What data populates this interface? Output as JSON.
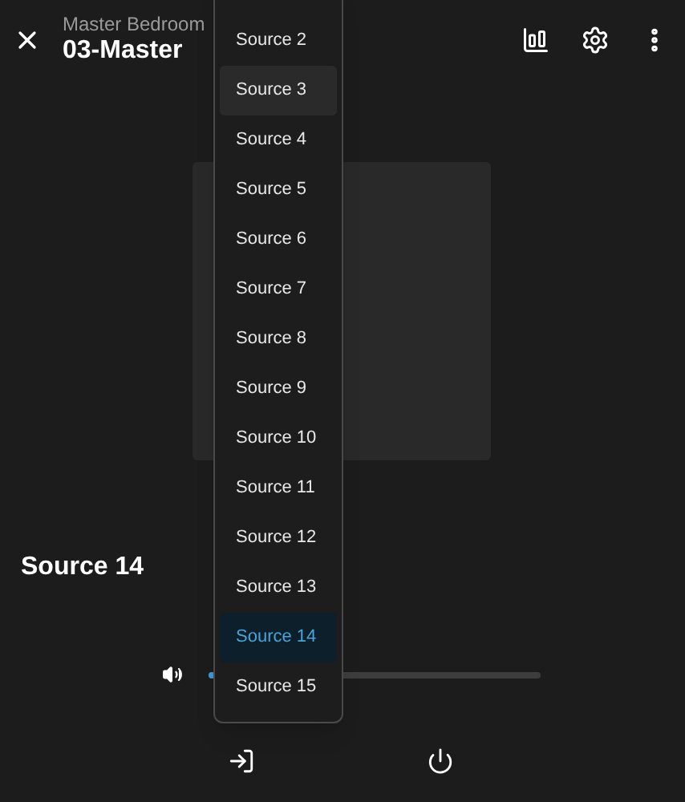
{
  "header": {
    "subtitle": "Master Bedroom",
    "title": "03-Master"
  },
  "now_playing": {
    "source": "Source 14"
  },
  "volume": {
    "level": 0.01
  },
  "source_menu": {
    "items": [
      {
        "label": "Source 2",
        "selected": false,
        "hovered": false
      },
      {
        "label": "Source 3",
        "selected": false,
        "hovered": true
      },
      {
        "label": "Source 4",
        "selected": false,
        "hovered": false
      },
      {
        "label": "Source 5",
        "selected": false,
        "hovered": false
      },
      {
        "label": "Source 6",
        "selected": false,
        "hovered": false
      },
      {
        "label": "Source 7",
        "selected": false,
        "hovered": false
      },
      {
        "label": "Source 8",
        "selected": false,
        "hovered": false
      },
      {
        "label": "Source 9",
        "selected": false,
        "hovered": false
      },
      {
        "label": "Source 10",
        "selected": false,
        "hovered": false
      },
      {
        "label": "Source 11",
        "selected": false,
        "hovered": false
      },
      {
        "label": "Source 12",
        "selected": false,
        "hovered": false
      },
      {
        "label": "Source 13",
        "selected": false,
        "hovered": false
      },
      {
        "label": "Source 14",
        "selected": true,
        "hovered": false
      },
      {
        "label": "Source 15",
        "selected": false,
        "hovered": false
      }
    ]
  }
}
